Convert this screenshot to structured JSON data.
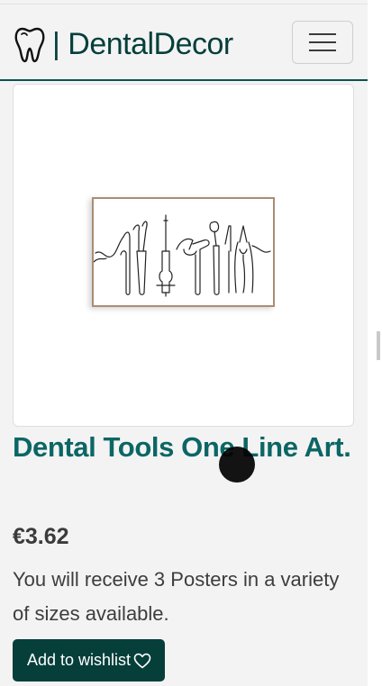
{
  "navbar": {
    "brand_text": "| DentalDecor",
    "brand_icon": "tooth-icon",
    "toggler_icon": "hamburger-icon"
  },
  "product": {
    "image_alt": "Dental Tools One Line Art.",
    "title": "Dental Tools One Line Art.",
    "price": "€3.62",
    "description": "You will receive 3 Posters in a variety of sizes available.",
    "wishlist_label": "Add to wishlist",
    "wishlist_icon": "heart-outline-icon"
  },
  "colors": {
    "brand_dark": "#063f3a",
    "title_teal": "#0b6664",
    "background": "#f3f3f4"
  }
}
